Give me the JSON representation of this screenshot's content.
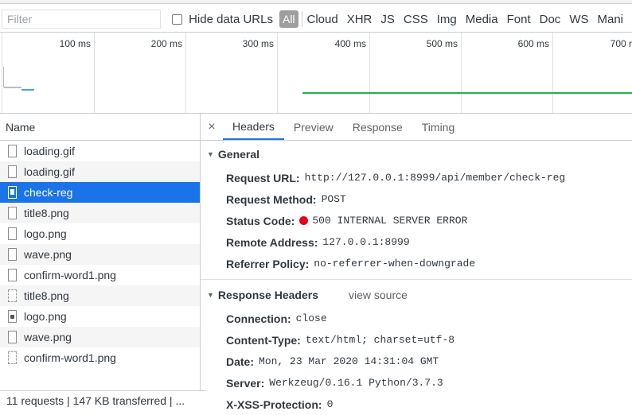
{
  "toolbar": {
    "filter_placeholder": "Filter",
    "hide_data_urls": "Hide data URLs",
    "types": [
      "All",
      "Cloud",
      "XHR",
      "JS",
      "CSS",
      "Img",
      "Media",
      "Font",
      "Doc",
      "WS",
      "Mani"
    ]
  },
  "timeline": {
    "ticks": [
      "100 ms",
      "200 ms",
      "300 ms",
      "400 ms",
      "500 ms",
      "600 ms",
      "700 r"
    ]
  },
  "name_column": {
    "header": "Name",
    "rows": [
      {
        "name": "loading.gif"
      },
      {
        "name": "loading.gif"
      },
      {
        "name": "check-reg"
      },
      {
        "name": "title8.png"
      },
      {
        "name": "logo.png"
      },
      {
        "name": "wave.png"
      },
      {
        "name": "confirm-word1.png"
      },
      {
        "name": "title8.png"
      },
      {
        "name": "logo.png"
      },
      {
        "name": "wave.png"
      },
      {
        "name": "confirm-word1.png"
      }
    ],
    "status": "11 requests | 147 KB transferred | ..."
  },
  "details": {
    "close": "×",
    "tabs": [
      "Headers",
      "Preview",
      "Response",
      "Timing"
    ],
    "general": {
      "title": "General",
      "request_url_label": "Request URL:",
      "request_url": "http://127.0.0.1:8999/api/member/check-reg",
      "request_method_label": "Request Method:",
      "request_method": "POST",
      "status_code_label": "Status Code:",
      "status_code": "500 INTERNAL SERVER ERROR",
      "remote_address_label": "Remote Address:",
      "remote_address": "127.0.0.1:8999",
      "referrer_policy_label": "Referrer Policy:",
      "referrer_policy": "no-referrer-when-downgrade"
    },
    "response_headers": {
      "title": "Response Headers",
      "view_source": "view source",
      "connection_label": "Connection:",
      "connection": "close",
      "content_type_label": "Content-Type:",
      "content_type": "text/html; charset=utf-8",
      "date_label": "Date:",
      "date": "Mon, 23 Mar 2020 14:31:04 GMT",
      "server_label": "Server:",
      "server": "Werkzeug/0.16.1 Python/3.7.3",
      "xss_label": "X-XSS-Protection:",
      "xss": "0"
    }
  }
}
